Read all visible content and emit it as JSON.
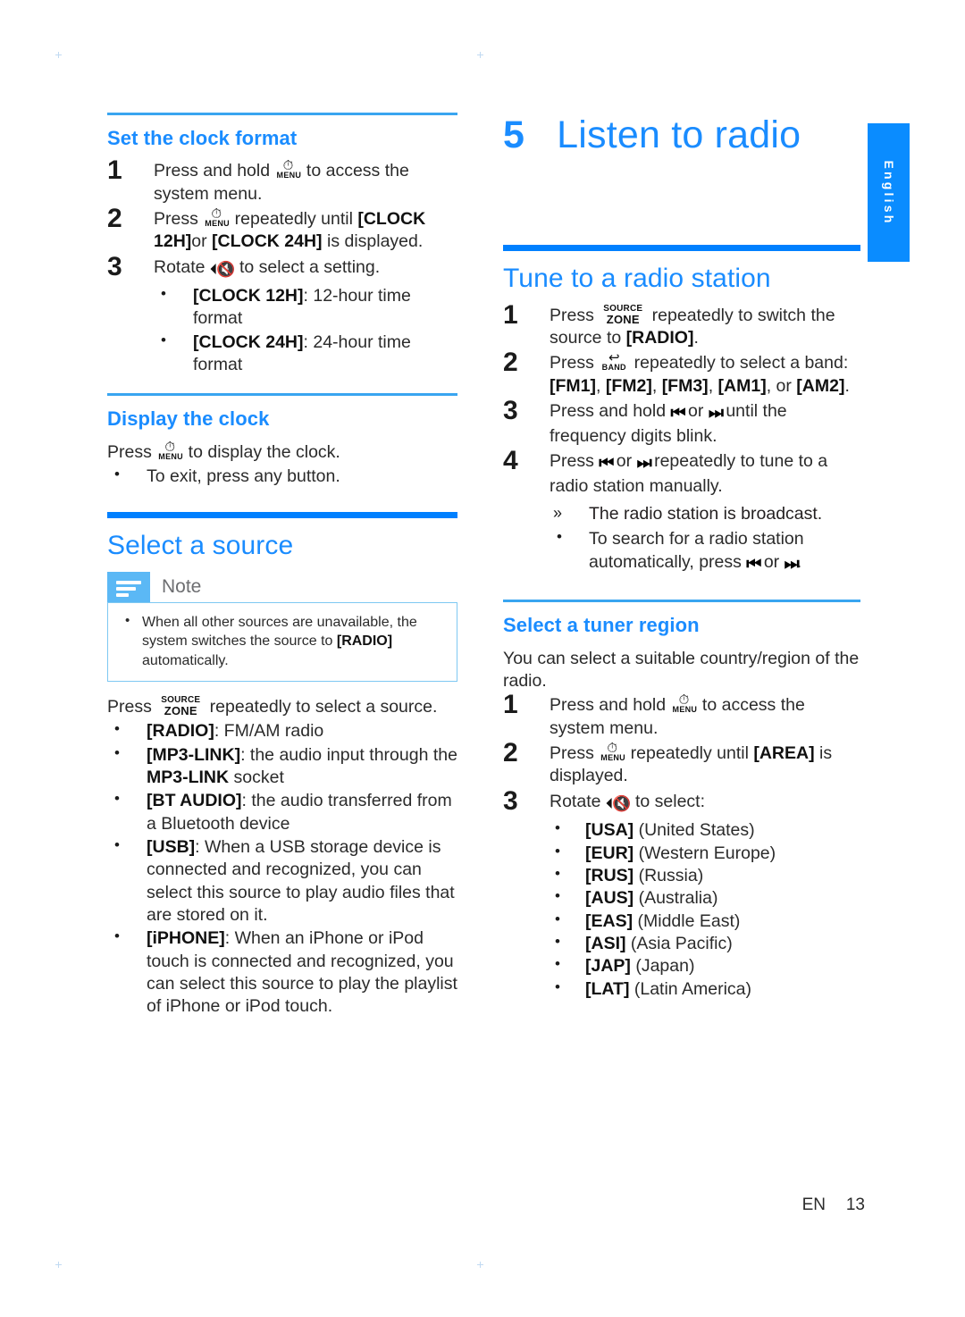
{
  "page": {
    "footer_locale": "EN",
    "footer_page": "13",
    "language_tab": "English",
    "accent_blue": "#1a8cff",
    "rule_blue": "#0080ff",
    "thin_rule_blue": "#39a5f0",
    "note_icon_blue": "#5bb8f5"
  },
  "left_column": {
    "clock_format": {
      "heading": "Set the clock format",
      "steps": [
        {
          "num": "1",
          "parts": [
            {
              "t": "Press and hold ",
              "s": "plain"
            },
            {
              "t": "MENU",
              "s": "key-menu"
            },
            {
              "t": " to access the system menu.",
              "s": "plain"
            }
          ]
        },
        {
          "num": "2",
          "parts": [
            {
              "t": "Press ",
              "s": "plain"
            },
            {
              "t": "MENU",
              "s": "key-menu"
            },
            {
              "t": " repeatedly until ",
              "s": "plain"
            },
            {
              "t": "[CLOCK 12H]",
              "s": "bold"
            },
            {
              "t": "or ",
              "s": "plain"
            },
            {
              "t": "[CLOCK 24H]",
              "s": "bold"
            },
            {
              "t": " is displayed.",
              "s": "plain"
            }
          ]
        },
        {
          "num": "3",
          "parts": [
            {
              "t": "Rotate ",
              "s": "plain"
            },
            {
              "t": "knob",
              "s": "key-knob"
            },
            {
              "t": " to select a setting.",
              "s": "plain"
            }
          ]
        }
      ],
      "bullets": [
        {
          "bold": "[CLOCK 12H]",
          "rest": ": 12-hour time format"
        },
        {
          "bold": "[CLOCK 24H]",
          "rest": ": 24-hour time format"
        }
      ]
    },
    "display_clock": {
      "heading": "Display the clock",
      "intro_parts": [
        {
          "t": "Press ",
          "s": "plain"
        },
        {
          "t": "MENU",
          "s": "key-menu"
        },
        {
          "t": " to display the clock.",
          "s": "plain"
        }
      ],
      "bullets": [
        {
          "bold": "",
          "rest": "To exit, press any button."
        }
      ]
    },
    "select_source": {
      "heading": "Select a source",
      "note": {
        "label": "Note",
        "items": [
          {
            "pre": "When all other sources are unavailable, the system switches the source to ",
            "bold": "[RADIO]",
            "post": " automatically."
          }
        ]
      },
      "intro_parts": [
        {
          "t": "Press ",
          "s": "plain"
        },
        {
          "t": "SOURCE ZONE",
          "s": "key-source"
        },
        {
          "t": " repeatedly to select a source.",
          "s": "plain"
        }
      ],
      "bullets": [
        {
          "bold": "[RADIO]",
          "rest": ": FM/AM radio"
        },
        {
          "bold": "[MP3-LINK]",
          "rest": ": the audio input through the ",
          "bold2": "MP3-LINK",
          "rest2": " socket"
        },
        {
          "bold": "[BT AUDIO]",
          "rest": ": the audio transferred from a Bluetooth device"
        },
        {
          "bold": "[USB]",
          "rest": ": When a USB storage device is connected and recognized, you can select this source to play audio files that are stored on it."
        },
        {
          "bold": "[iPHONE]",
          "rest": ": When an iPhone or iPod touch is connected and recognized, you can select this source to play the playlist of iPhone or iPod touch."
        }
      ]
    }
  },
  "right_column": {
    "chapter": {
      "number": "5",
      "title": "Listen to radio"
    },
    "tune_station": {
      "heading": "Tune to a radio station",
      "steps": [
        {
          "num": "1",
          "parts": [
            {
              "t": "Press ",
              "s": "plain"
            },
            {
              "t": "SOURCE ZONE",
              "s": "key-source"
            },
            {
              "t": " repeatedly to switch the source to ",
              "s": "plain"
            },
            {
              "t": "[RADIO]",
              "s": "bold"
            },
            {
              "t": ".",
              "s": "plain"
            }
          ]
        },
        {
          "num": "2",
          "parts": [
            {
              "t": "Press ",
              "s": "plain"
            },
            {
              "t": "BAND",
              "s": "key-band"
            },
            {
              "t": " repeatedly to select a band: ",
              "s": "plain"
            },
            {
              "t": "[FM1]",
              "s": "bold"
            },
            {
              "t": ", ",
              "s": "plain"
            },
            {
              "t": "[FM2]",
              "s": "bold"
            },
            {
              "t": ", ",
              "s": "plain"
            },
            {
              "t": "[FM3]",
              "s": "bold"
            },
            {
              "t": ", ",
              "s": "plain"
            },
            {
              "t": "[AM1]",
              "s": "bold"
            },
            {
              "t": ", or ",
              "s": "plain"
            },
            {
              "t": "[AM2]",
              "s": "bold"
            },
            {
              "t": ".",
              "s": "plain"
            }
          ]
        },
        {
          "num": "3",
          "parts": [
            {
              "t": "Press and hold ",
              "s": "plain"
            },
            {
              "t": "prev",
              "s": "key-prev"
            },
            {
              "t": " or ",
              "s": "plain"
            },
            {
              "t": "next",
              "s": "key-next"
            },
            {
              "t": " until the frequency digits blink.",
              "s": "plain"
            }
          ]
        },
        {
          "num": "4",
          "parts": [
            {
              "t": "Press ",
              "s": "plain"
            },
            {
              "t": "prev",
              "s": "key-prev"
            },
            {
              "t": " or ",
              "s": "plain"
            },
            {
              "t": "next",
              "s": "key-next"
            },
            {
              "t": " repeatedly to tune to a radio station manually.",
              "s": "plain"
            }
          ]
        }
      ],
      "result": "The radio station is broadcast.",
      "tip_parts": [
        {
          "t": "To search for a radio station automatically, press ",
          "s": "plain"
        },
        {
          "t": "prev",
          "s": "key-prev"
        },
        {
          "t": " or ",
          "s": "plain"
        },
        {
          "t": "next",
          "s": "key-next"
        },
        {
          "t": ".",
          "s": "plain"
        }
      ]
    },
    "tuner_region": {
      "heading": "Select a tuner region",
      "intro": "You can select a suitable country/region of the radio.",
      "steps": [
        {
          "num": "1",
          "parts": [
            {
              "t": "Press and hold ",
              "s": "plain"
            },
            {
              "t": "MENU",
              "s": "key-menu"
            },
            {
              "t": " to access the system menu.",
              "s": "plain"
            }
          ]
        },
        {
          "num": "2",
          "parts": [
            {
              "t": "Press ",
              "s": "plain"
            },
            {
              "t": "MENU",
              "s": "key-menu"
            },
            {
              "t": " repeatedly until ",
              "s": "plain"
            },
            {
              "t": "[AREA]",
              "s": "bold"
            },
            {
              "t": " is displayed.",
              "s": "plain"
            }
          ]
        },
        {
          "num": "3",
          "parts": [
            {
              "t": "Rotate ",
              "s": "plain"
            },
            {
              "t": "knob",
              "s": "key-knob"
            },
            {
              "t": " to select:",
              "s": "plain"
            }
          ]
        }
      ],
      "regions": [
        {
          "code": "[USA]",
          "name": " (United States)"
        },
        {
          "code": "[EUR]",
          "name": " (Western Europe)"
        },
        {
          "code": "[RUS]",
          "name": " (Russia)"
        },
        {
          "code": "[AUS]",
          "name": " (Australia)"
        },
        {
          "code": "[EAS]",
          "name": " (Middle East)"
        },
        {
          "code": "[ASI]",
          "name": " (Asia Pacific)"
        },
        {
          "code": "[JAP]",
          "name": " (Japan)"
        },
        {
          "code": "[LAT]",
          "name": " (Latin America)"
        }
      ]
    }
  }
}
